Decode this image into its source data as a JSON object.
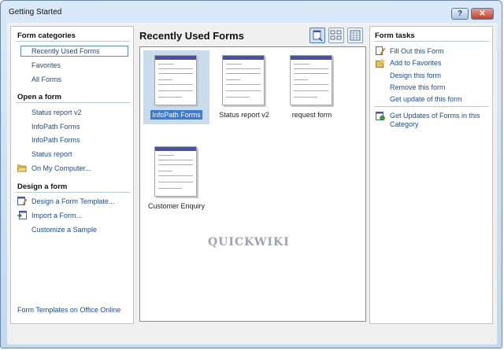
{
  "window": {
    "title": "Getting Started",
    "help_label": "?",
    "close_label": "✕"
  },
  "left": {
    "categories_header": "Form categories",
    "categories": [
      {
        "label": "Recently Used Forms",
        "selected": true
      },
      {
        "label": "Favorites"
      },
      {
        "label": "All Forms"
      }
    ],
    "open_header": "Open a form",
    "open_items": [
      "Status report v2",
      "InfoPath Forms",
      "InfoPath Forms",
      "Status report",
      "On My Computer..."
    ],
    "design_header": "Design a form",
    "design_items": [
      "Design a Form Template...",
      "Import a Form...",
      "Customize a Sample"
    ],
    "bottom_link": "Form Templates on Office Online"
  },
  "main": {
    "title": "Recently Used Forms",
    "forms": [
      {
        "label": "InfoPath Forms",
        "selected": true
      },
      {
        "label": "Status report v2"
      },
      {
        "label": "request  form"
      },
      {
        "label": "Customer Enquiry"
      }
    ],
    "watermark": "QUICKWIKI"
  },
  "right": {
    "header": "Form tasks",
    "tasks": [
      "Fill Out this Form",
      "Add to Favorites",
      "Design this form",
      "Remove this form",
      "Get update of this form"
    ],
    "category_task": "Get Updates of Forms in this Category"
  },
  "colors": {
    "link": "#1d4b8f",
    "selection": "#3a7bd5",
    "accent_bar": "#4b4fa8"
  }
}
